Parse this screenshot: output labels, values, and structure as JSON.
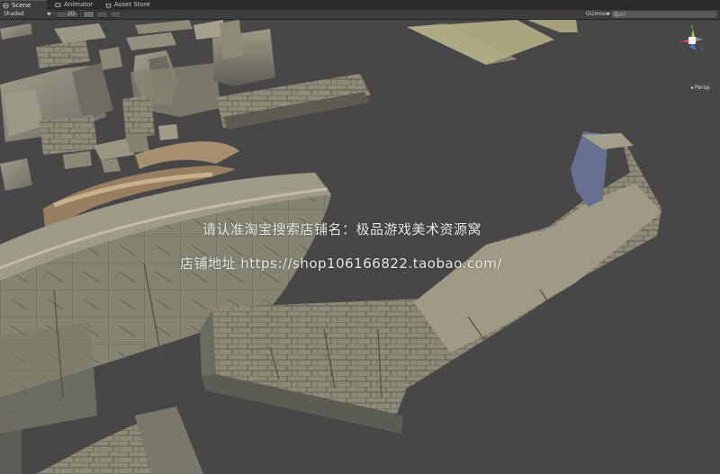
{
  "tabs": [
    {
      "label": "Scene",
      "active": true,
      "icon": "scene-icon"
    },
    {
      "label": "Animator",
      "active": false,
      "icon": "animator-icon"
    },
    {
      "label": "Asset Store",
      "active": false,
      "icon": "asset-store-icon"
    }
  ],
  "toolbar": {
    "shading_mode": "Shaded",
    "mode_2d": "2D",
    "gizmos_label": "Gizmos",
    "search_placeholder": "All",
    "icons": [
      "lighting-toggle-icon",
      "audio-toggle-icon",
      "effects-toggle-icon"
    ]
  },
  "viewport": {
    "projection_label": "Persp",
    "gizmo_axes": [
      "y",
      "x",
      "z"
    ],
    "watermark_line1": "请认准淘宝搜索店铺名：极品游戏美术资源窝",
    "watermark_line2": "店铺地址 https://shop106166822.taobao.com/"
  },
  "colors": {
    "viewport_bg": "#474747",
    "stone": "#8c8a7d",
    "grass_plane": "#a8a57e",
    "axis_y": "#9ad24a",
    "axis_x": "#d84a3a",
    "axis_z": "#4a7ad8"
  }
}
